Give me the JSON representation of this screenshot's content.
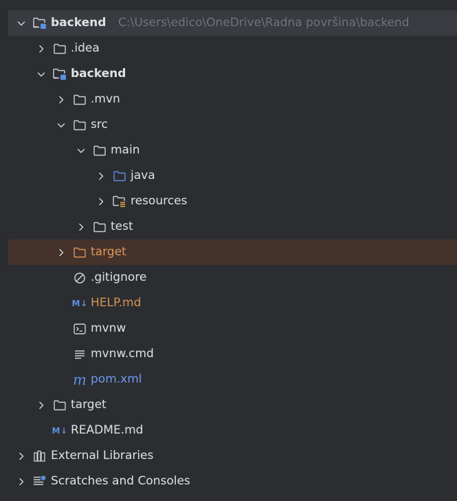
{
  "project": {
    "name": "backend",
    "path": "C:\\Users\\edico\\OneDrive\\Radna površina\\backend"
  },
  "tree": [
    {
      "label": "backend",
      "depth": 0,
      "chevron": "down",
      "icon": "module-folder-icon",
      "style": "bold"
    },
    {
      "label": ".idea",
      "depth": 1,
      "chevron": "right",
      "icon": "folder-icon",
      "style": "normal"
    },
    {
      "label": "backend",
      "depth": 1,
      "chevron": "down",
      "icon": "module-folder-icon",
      "style": "bold"
    },
    {
      "label": ".mvn",
      "depth": 2,
      "chevron": "right",
      "icon": "folder-icon",
      "style": "normal"
    },
    {
      "label": "src",
      "depth": 2,
      "chevron": "down",
      "icon": "folder-icon",
      "style": "normal"
    },
    {
      "label": "main",
      "depth": 3,
      "chevron": "down",
      "icon": "folder-icon",
      "style": "normal"
    },
    {
      "label": "java",
      "depth": 4,
      "chevron": "right",
      "icon": "source-folder-icon",
      "style": "normal"
    },
    {
      "label": "resources",
      "depth": 4,
      "chevron": "right",
      "icon": "resources-folder-icon",
      "style": "normal"
    },
    {
      "label": "test",
      "depth": 3,
      "chevron": "right",
      "icon": "folder-icon",
      "style": "normal"
    },
    {
      "label": "target",
      "depth": 2,
      "chevron": "right",
      "icon": "excluded-folder-icon",
      "style": "excluded"
    },
    {
      "label": ".gitignore",
      "depth": 2,
      "chevron": "none",
      "icon": "ignore-file-icon",
      "style": "normal"
    },
    {
      "label": "HELP.md",
      "depth": 2,
      "chevron": "none",
      "icon": "markdown-icon",
      "icon_text": "M↓",
      "style": "vcs-added"
    },
    {
      "label": "mvnw",
      "depth": 2,
      "chevron": "none",
      "icon": "terminal-script-icon",
      "style": "normal"
    },
    {
      "label": "mvnw.cmd",
      "depth": 2,
      "chevron": "none",
      "icon": "text-file-icon",
      "style": "normal"
    },
    {
      "label": "pom.xml",
      "depth": 2,
      "chevron": "none",
      "icon": "maven-icon",
      "icon_text": "m",
      "style": "modified"
    },
    {
      "label": "target",
      "depth": 1,
      "chevron": "right",
      "icon": "folder-icon",
      "style": "normal"
    },
    {
      "label": "README.md",
      "depth": 1,
      "chevron": "none",
      "icon": "markdown-icon",
      "icon_text": "M↓",
      "style": "normal"
    },
    {
      "label": "External Libraries",
      "depth": 0,
      "chevron": "right",
      "icon": "libraries-icon",
      "style": "normal"
    },
    {
      "label": "Scratches and Consoles",
      "depth": 0,
      "chevron": "right",
      "icon": "scratches-icon",
      "style": "normal"
    }
  ],
  "colors": {
    "background": "#2b2d30",
    "selected_row": "#393b40",
    "excluded_row": "#45322b",
    "text": "#dfe1e5",
    "path_text": "#6f737a",
    "excluded_text": "#e0965a",
    "vcs_added_text": "#d59453",
    "modified_text": "#6f9bf0",
    "accent_blue": "#5d8fe0"
  }
}
